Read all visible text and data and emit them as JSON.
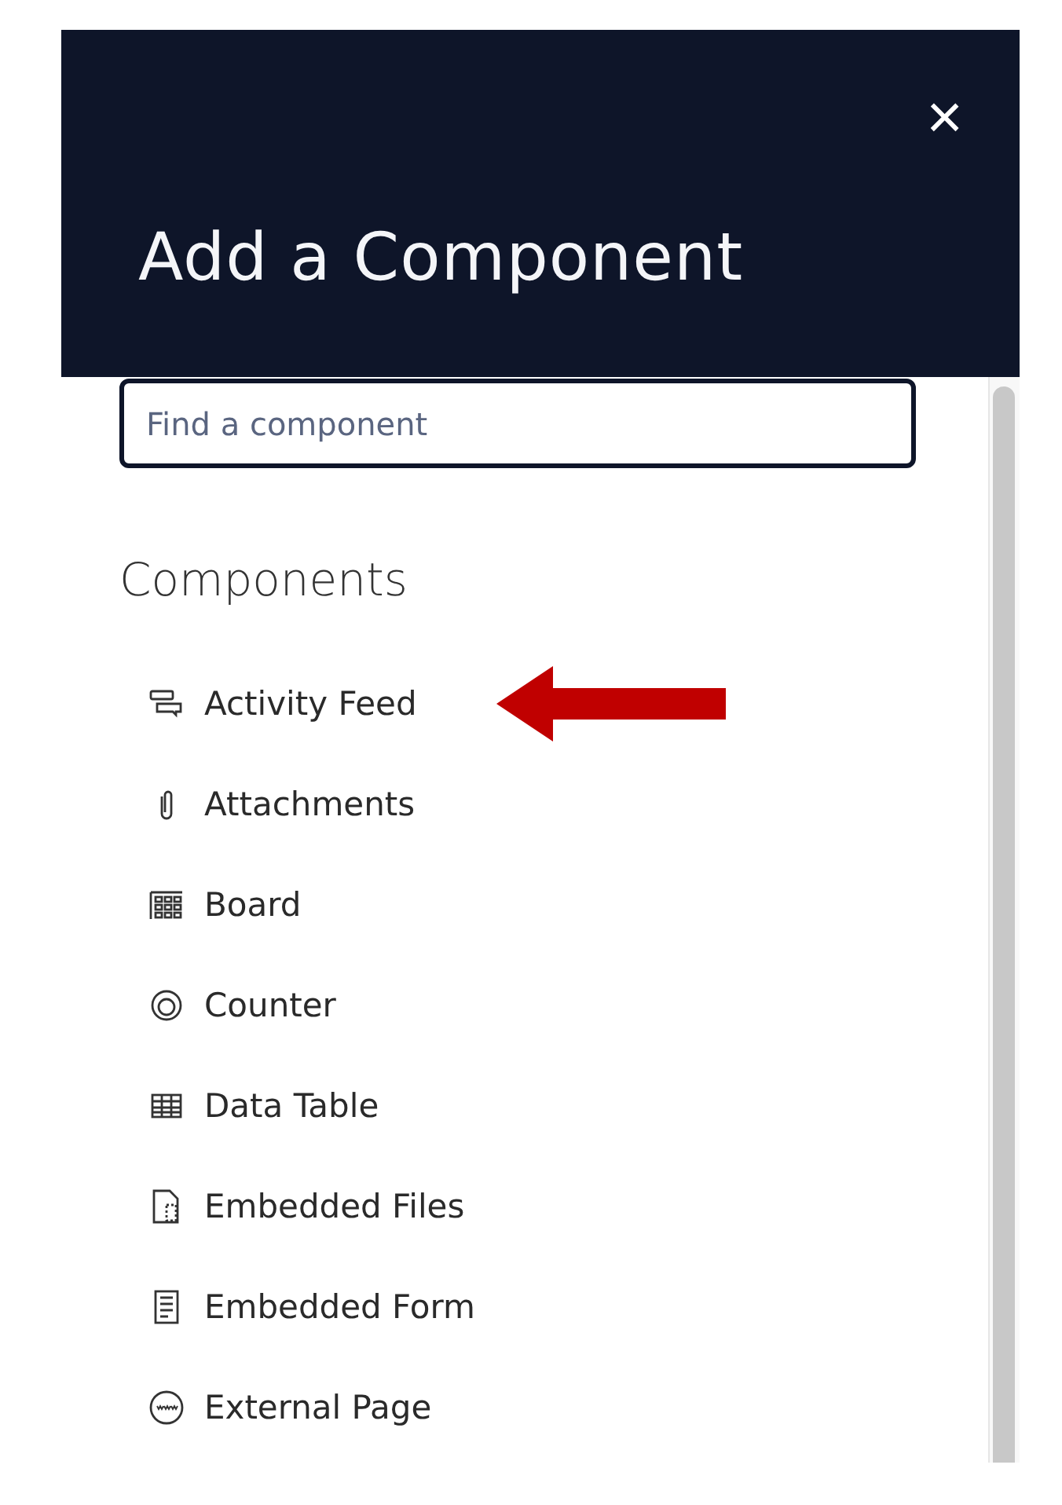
{
  "panel": {
    "title": "Add a Component",
    "close": "×"
  },
  "search": {
    "placeholder": "Find a component"
  },
  "section": {
    "heading": "Components"
  },
  "items": [
    {
      "label": "Activity Feed",
      "kind": "feed",
      "pointed": true
    },
    {
      "label": "Attachments",
      "kind": "clip",
      "pointed": false
    },
    {
      "label": "Board",
      "kind": "board",
      "pointed": false
    },
    {
      "label": "Counter",
      "kind": "counter",
      "pointed": false
    },
    {
      "label": "Data Table",
      "kind": "table",
      "pointed": false
    },
    {
      "label": "Embedded Files",
      "kind": "file",
      "pointed": false
    },
    {
      "label": "Embedded Form",
      "kind": "form",
      "pointed": false
    },
    {
      "label": "External Page",
      "kind": "www",
      "pointed": false
    }
  ],
  "annotation": {
    "color": "#c00000"
  }
}
